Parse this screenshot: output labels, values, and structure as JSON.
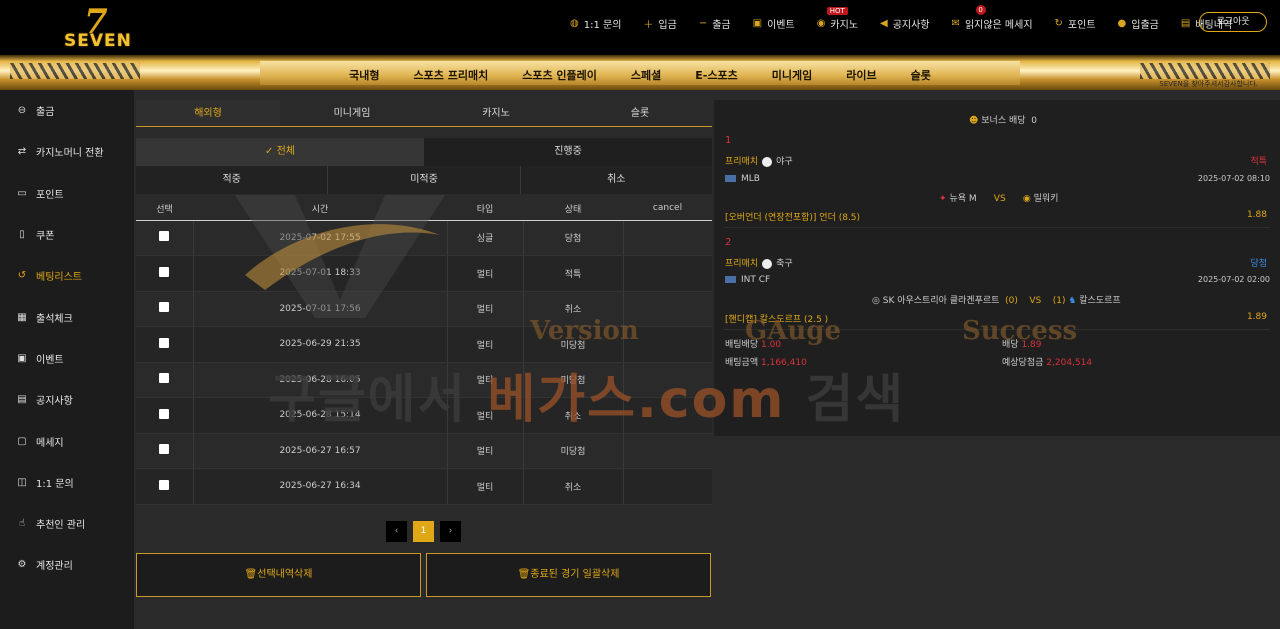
{
  "brand": {
    "logo_text": "SEVEN",
    "accent": "#e0a817"
  },
  "topnav": {
    "items": [
      {
        "label": "1:1 문의",
        "icon": "chat-icon"
      },
      {
        "label": "입금",
        "icon": "plus-icon"
      },
      {
        "label": "출금",
        "icon": "minus-icon"
      },
      {
        "label": "이벤트",
        "icon": "gift-icon"
      },
      {
        "label": "카지노",
        "icon": "chip-icon",
        "badge": "HOT"
      },
      {
        "label": "공지사항",
        "icon": "megaphone-icon"
      },
      {
        "label": "읽지않은 메세지",
        "icon": "mail-icon",
        "count": "0"
      },
      {
        "label": "포인트",
        "icon": "refresh-icon"
      },
      {
        "label": "입출금",
        "icon": "moneybag-icon"
      },
      {
        "label": "배팅내역",
        "icon": "ticket-icon"
      }
    ],
    "logout_label": "로그아웃"
  },
  "mainnav": [
    "국내형",
    "스포츠 프리매치",
    "스포츠 인플레이",
    "스페셜",
    "E-스포츠",
    "미니게임",
    "라이브",
    "슬롯"
  ],
  "mainnav_note": "SEVEN을 찾아주셔서감사합니다.",
  "sidebar": [
    {
      "label": "출금",
      "icon": "withdraw-icon"
    },
    {
      "label": "카지노머니 전환",
      "icon": "exchange-icon"
    },
    {
      "label": "포인트",
      "icon": "point-icon"
    },
    {
      "label": "쿠폰",
      "icon": "coupon-icon"
    },
    {
      "label": "베팅리스트",
      "icon": "history-icon",
      "active": true
    },
    {
      "label": "출석체크",
      "icon": "calendar-icon"
    },
    {
      "label": "이벤트",
      "icon": "event-icon"
    },
    {
      "label": "공지사항",
      "icon": "notice-icon"
    },
    {
      "label": "메세지",
      "icon": "message-icon"
    },
    {
      "label": "1:1 문의",
      "icon": "inquiry-icon"
    },
    {
      "label": "추천인 관리",
      "icon": "referral-icon"
    },
    {
      "label": "계정관리",
      "icon": "settings-icon"
    }
  ],
  "tabs1": [
    "해외형",
    "미니게임",
    "카지노",
    "슬롯"
  ],
  "tabs2": [
    "✓ 전체",
    "진행중"
  ],
  "tabs3": [
    "적중",
    "미적중",
    "취소"
  ],
  "table": {
    "headers": [
      "선택",
      "시간",
      "타입",
      "상태",
      "cancel"
    ],
    "rows": [
      {
        "time": "2025-07-02 17:55",
        "type": "싱글",
        "status": "당첨",
        "kind": "win"
      },
      {
        "time": "2025-07-01 18:33",
        "type": "멀티",
        "status": "적특",
        "kind": "lose"
      },
      {
        "time": "2025-07-01 17:56",
        "type": "멀티",
        "status": "취소",
        "kind": "cancel"
      },
      {
        "time": "2025-06-29 21:35",
        "type": "멀티",
        "status": "미당첨",
        "kind": "miss"
      },
      {
        "time": "2025-06-28 16:05",
        "type": "멀티",
        "status": "미당첨",
        "kind": "miss"
      },
      {
        "time": "2025-06-28 15:14",
        "type": "멀티",
        "status": "취소",
        "kind": "cancel"
      },
      {
        "time": "2025-06-27 16:57",
        "type": "멀티",
        "status": "미당첨",
        "kind": "miss"
      },
      {
        "time": "2025-06-27 16:34",
        "type": "멀티",
        "status": "취소",
        "kind": "cancel"
      }
    ]
  },
  "pager": {
    "prev": "‹",
    "current": "1",
    "next": "›"
  },
  "buttons": {
    "delete_selected": "🗑선택내역삭제",
    "delete_finished": "🗑종료된 경기 일괄삭제"
  },
  "detail": {
    "bonus_label": "보너스 배당",
    "bonus_value": "0",
    "items": [
      {
        "no": "1",
        "category": "프리매치",
        "sport": "야구",
        "result": "적특",
        "league": "MLB",
        "datetime": "2025-07-02 08:10",
        "home": "뉴욕 M",
        "vs": "VS",
        "away": "밀워키",
        "pick": "[오버언더 (연장전포함)] 언더 (8.5)",
        "odds": "1.88"
      },
      {
        "no": "2",
        "category": "프리매치",
        "sport": "축구",
        "result": "당첨",
        "league": "INT CF",
        "datetime": "2025-07-02 02:00",
        "home": "SK 아우스트리아 클라겐푸르트",
        "home_score": "(0)",
        "vs": "VS",
        "away_score": "(1)",
        "away": "칼스도르프",
        "pick": "[핸디캡] 칼스도르프 (2.5 )",
        "odds": "1.89"
      }
    ],
    "summary": {
      "bet_odds_label": "배팅배당",
      "bet_odds_value": "1.00",
      "dividend_label": "배당",
      "dividend_value": "1.89",
      "bet_amount_label": "배팅금액",
      "bet_amount_value": "1,166,410",
      "expected_label": "예상당첨금",
      "expected_value": "2,204,514"
    }
  },
  "watermark": {
    "main_a": "구글에서 ",
    "main_b": "베가스.com",
    "main_c": " 검색",
    "sub": [
      "Version",
      "GAuge",
      "Success"
    ]
  }
}
